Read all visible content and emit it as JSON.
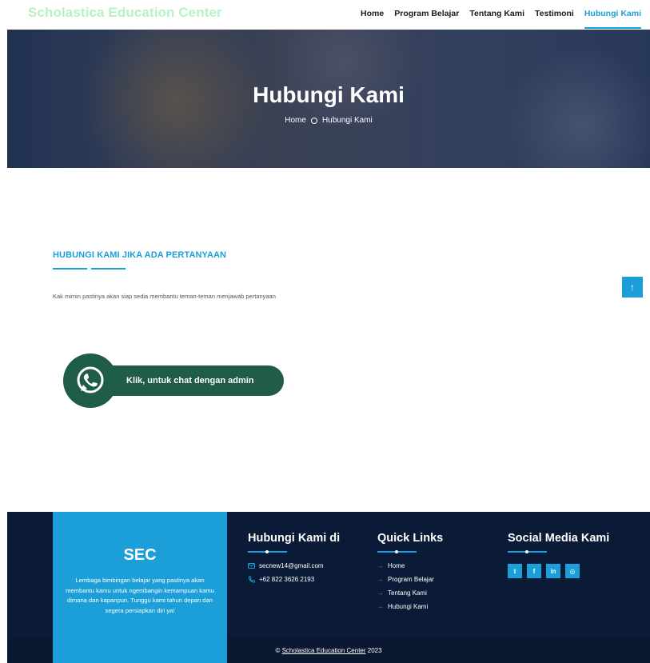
{
  "header": {
    "brand": "Scholastica Education Center",
    "nav": [
      {
        "label": "Home"
      },
      {
        "label": "Program Belajar"
      },
      {
        "label": "Tentang Kami"
      },
      {
        "label": "Testimoni"
      },
      {
        "label": "Hubungi Kami",
        "active": true
      }
    ]
  },
  "hero": {
    "title": "Hubungi Kami",
    "breadcrumb": {
      "home": "Home",
      "current": "Hubungi Kami"
    }
  },
  "contact": {
    "heading": "HUBUNGI KAMI JIKA ADA PERTANYAAN",
    "description": "Kak mimin pastinya akan siap sedia membantu teman-teman menjawab pertanyaan",
    "whatsapp_button": "Klik, untuk chat dengan admin"
  },
  "footer": {
    "sec_title": "SEC",
    "sec_description": "Lembaga bimbingan belajar yang pastinya akan membantu kamu untuk ngembangin kemampuan kamu dimana dan kapanpun. Tunggu kami tahun depan dan segera persiapkan diri ya!",
    "contact_title": "Hubungi Kami di",
    "email": "secnew14@gmail.com",
    "phone": "+62 822 3626 2193",
    "quick_links_title": "Quick Links",
    "quick_links": [
      "Home",
      "Program Belajar",
      "Tentang Kami",
      "Hubungi Kami"
    ],
    "social_title": "Social Media Kami",
    "socials": [
      {
        "icon": "twitter-icon",
        "glyph": "t"
      },
      {
        "icon": "facebook-icon",
        "glyph": "f"
      },
      {
        "icon": "linkedin-icon",
        "glyph": "in"
      },
      {
        "icon": "instagram-icon",
        "glyph": "◎"
      }
    ],
    "copyright_prefix": "©",
    "copyright_name": "Scholastica Education Center",
    "copyright_year": "2023"
  },
  "colors": {
    "accent": "#1c9fd8",
    "brand": "#b9f0c6",
    "footer_bg": "#0b1a36",
    "whatsapp": "#1f5c4a"
  }
}
